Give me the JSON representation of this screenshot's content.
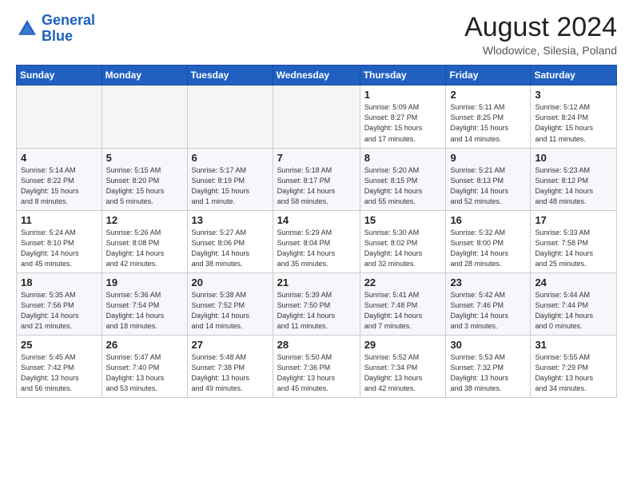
{
  "header": {
    "logo_line1": "General",
    "logo_line2": "Blue",
    "month_year": "August 2024",
    "location": "Wlodowice, Silesia, Poland"
  },
  "weekdays": [
    "Sunday",
    "Monday",
    "Tuesday",
    "Wednesday",
    "Thursday",
    "Friday",
    "Saturday"
  ],
  "weeks": [
    [
      {
        "day": "",
        "info": "",
        "empty": true
      },
      {
        "day": "",
        "info": "",
        "empty": true
      },
      {
        "day": "",
        "info": "",
        "empty": true
      },
      {
        "day": "",
        "info": "",
        "empty": true
      },
      {
        "day": "1",
        "info": "Sunrise: 5:09 AM\nSunset: 8:27 PM\nDaylight: 15 hours\nand 17 minutes.",
        "empty": false
      },
      {
        "day": "2",
        "info": "Sunrise: 5:11 AM\nSunset: 8:25 PM\nDaylight: 15 hours\nand 14 minutes.",
        "empty": false
      },
      {
        "day": "3",
        "info": "Sunrise: 5:12 AM\nSunset: 8:24 PM\nDaylight: 15 hours\nand 11 minutes.",
        "empty": false
      }
    ],
    [
      {
        "day": "4",
        "info": "Sunrise: 5:14 AM\nSunset: 8:22 PM\nDaylight: 15 hours\nand 8 minutes.",
        "empty": false
      },
      {
        "day": "5",
        "info": "Sunrise: 5:15 AM\nSunset: 8:20 PM\nDaylight: 15 hours\nand 5 minutes.",
        "empty": false
      },
      {
        "day": "6",
        "info": "Sunrise: 5:17 AM\nSunset: 8:19 PM\nDaylight: 15 hours\nand 1 minute.",
        "empty": false
      },
      {
        "day": "7",
        "info": "Sunrise: 5:18 AM\nSunset: 8:17 PM\nDaylight: 14 hours\nand 58 minutes.",
        "empty": false
      },
      {
        "day": "8",
        "info": "Sunrise: 5:20 AM\nSunset: 8:15 PM\nDaylight: 14 hours\nand 55 minutes.",
        "empty": false
      },
      {
        "day": "9",
        "info": "Sunrise: 5:21 AM\nSunset: 8:13 PM\nDaylight: 14 hours\nand 52 minutes.",
        "empty": false
      },
      {
        "day": "10",
        "info": "Sunrise: 5:23 AM\nSunset: 8:12 PM\nDaylight: 14 hours\nand 48 minutes.",
        "empty": false
      }
    ],
    [
      {
        "day": "11",
        "info": "Sunrise: 5:24 AM\nSunset: 8:10 PM\nDaylight: 14 hours\nand 45 minutes.",
        "empty": false
      },
      {
        "day": "12",
        "info": "Sunrise: 5:26 AM\nSunset: 8:08 PM\nDaylight: 14 hours\nand 42 minutes.",
        "empty": false
      },
      {
        "day": "13",
        "info": "Sunrise: 5:27 AM\nSunset: 8:06 PM\nDaylight: 14 hours\nand 38 minutes.",
        "empty": false
      },
      {
        "day": "14",
        "info": "Sunrise: 5:29 AM\nSunset: 8:04 PM\nDaylight: 14 hours\nand 35 minutes.",
        "empty": false
      },
      {
        "day": "15",
        "info": "Sunrise: 5:30 AM\nSunset: 8:02 PM\nDaylight: 14 hours\nand 32 minutes.",
        "empty": false
      },
      {
        "day": "16",
        "info": "Sunrise: 5:32 AM\nSunset: 8:00 PM\nDaylight: 14 hours\nand 28 minutes.",
        "empty": false
      },
      {
        "day": "17",
        "info": "Sunrise: 5:33 AM\nSunset: 7:58 PM\nDaylight: 14 hours\nand 25 minutes.",
        "empty": false
      }
    ],
    [
      {
        "day": "18",
        "info": "Sunrise: 5:35 AM\nSunset: 7:56 PM\nDaylight: 14 hours\nand 21 minutes.",
        "empty": false
      },
      {
        "day": "19",
        "info": "Sunrise: 5:36 AM\nSunset: 7:54 PM\nDaylight: 14 hours\nand 18 minutes.",
        "empty": false
      },
      {
        "day": "20",
        "info": "Sunrise: 5:38 AM\nSunset: 7:52 PM\nDaylight: 14 hours\nand 14 minutes.",
        "empty": false
      },
      {
        "day": "21",
        "info": "Sunrise: 5:39 AM\nSunset: 7:50 PM\nDaylight: 14 hours\nand 11 minutes.",
        "empty": false
      },
      {
        "day": "22",
        "info": "Sunrise: 5:41 AM\nSunset: 7:48 PM\nDaylight: 14 hours\nand 7 minutes.",
        "empty": false
      },
      {
        "day": "23",
        "info": "Sunrise: 5:42 AM\nSunset: 7:46 PM\nDaylight: 14 hours\nand 3 minutes.",
        "empty": false
      },
      {
        "day": "24",
        "info": "Sunrise: 5:44 AM\nSunset: 7:44 PM\nDaylight: 14 hours\nand 0 minutes.",
        "empty": false
      }
    ],
    [
      {
        "day": "25",
        "info": "Sunrise: 5:45 AM\nSunset: 7:42 PM\nDaylight: 13 hours\nand 56 minutes.",
        "empty": false
      },
      {
        "day": "26",
        "info": "Sunrise: 5:47 AM\nSunset: 7:40 PM\nDaylight: 13 hours\nand 53 minutes.",
        "empty": false
      },
      {
        "day": "27",
        "info": "Sunrise: 5:48 AM\nSunset: 7:38 PM\nDaylight: 13 hours\nand 49 minutes.",
        "empty": false
      },
      {
        "day": "28",
        "info": "Sunrise: 5:50 AM\nSunset: 7:36 PM\nDaylight: 13 hours\nand 45 minutes.",
        "empty": false
      },
      {
        "day": "29",
        "info": "Sunrise: 5:52 AM\nSunset: 7:34 PM\nDaylight: 13 hours\nand 42 minutes.",
        "empty": false
      },
      {
        "day": "30",
        "info": "Sunrise: 5:53 AM\nSunset: 7:32 PM\nDaylight: 13 hours\nand 38 minutes.",
        "empty": false
      },
      {
        "day": "31",
        "info": "Sunrise: 5:55 AM\nSunset: 7:29 PM\nDaylight: 13 hours\nand 34 minutes.",
        "empty": false
      }
    ]
  ]
}
